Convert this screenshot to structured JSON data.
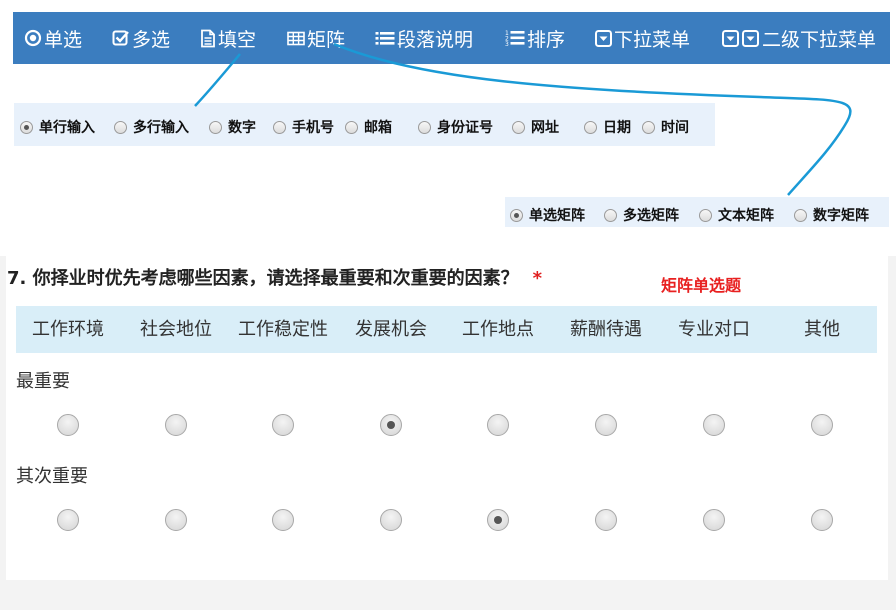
{
  "toolbar": {
    "items": [
      {
        "label": "单选",
        "icon": "radio-circle-icon"
      },
      {
        "label": "多选",
        "icon": "checkbox-icon"
      },
      {
        "label": "填空",
        "icon": "document-icon"
      },
      {
        "label": "矩阵",
        "icon": "table-icon"
      },
      {
        "label": "段落说明",
        "icon": "list-icon"
      },
      {
        "label": "排序",
        "icon": "ordered-list-icon"
      },
      {
        "label": "下拉菜单",
        "icon": "dropdown-icon"
      },
      {
        "label": "二级下拉菜单",
        "icon": "double-dropdown-icon"
      }
    ],
    "color": "#3b7dbf"
  },
  "fill_types": {
    "options": [
      "单行输入",
      "多行输入",
      "数字",
      "手机号",
      "邮箱",
      "身份证号",
      "网址",
      "日期",
      "时间"
    ],
    "selected_index": 0
  },
  "matrix_types": {
    "options": [
      "单选矩阵",
      "多选矩阵",
      "文本矩阵",
      "数字矩阵"
    ],
    "selected_index": 0
  },
  "question": {
    "title": "7. 你择业时优先考虑哪些因素，请选择最重要和次重要的因素？",
    "required_mark": "*",
    "type_note": "矩阵单选题",
    "columns": [
      "工作环境",
      "社会地位",
      "工作稳定性",
      "发展机会",
      "工作地点",
      "薪酬待遇",
      "专业对口",
      "其他"
    ],
    "rows": [
      {
        "label": "最重要",
        "selected_index": 3
      },
      {
        "label": "其次重要",
        "selected_index": 4
      }
    ]
  },
  "colors": {
    "header_bg": "#d9eef8",
    "panel_bg": "#e8f1fb",
    "connector": "#1a9ad6",
    "required": "#e02020"
  }
}
